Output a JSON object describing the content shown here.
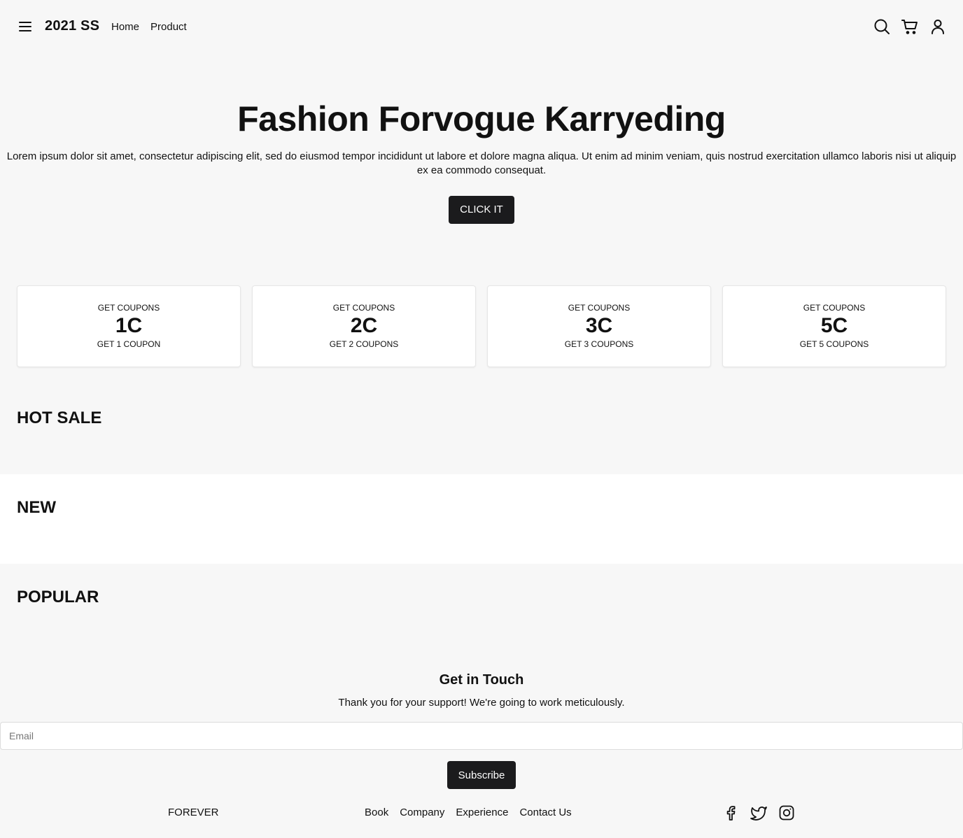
{
  "header": {
    "brand": "2021 SS",
    "nav": [
      "Home",
      "Product"
    ],
    "icons": [
      "menu-icon",
      "search-icon",
      "cart-icon",
      "user-icon"
    ]
  },
  "hero": {
    "title": "Fashion Forvogue Karryeding",
    "description": "Lorem ipsum dolor sit amet, consectetur adipiscing elit, sed do eiusmod tempor incididunt ut labore et dolore magna aliqua. Ut enim ad minim veniam, quis nostrud exercitation ullamco laboris nisi ut aliquip ex ea commodo consequat.",
    "button": "CLICK IT"
  },
  "coupons": [
    {
      "top": "GET COUPONS",
      "value": "1C",
      "bottom": "GET 1 COUPON"
    },
    {
      "top": "GET COUPONS",
      "value": "2C",
      "bottom": "GET 2 COUPONS"
    },
    {
      "top": "GET COUPONS",
      "value": "3C",
      "bottom": "GET 3 COUPONS"
    },
    {
      "top": "GET COUPONS",
      "value": "5C",
      "bottom": "GET 5 COUPONS"
    }
  ],
  "sections": {
    "hot_sale": "HOT SALE",
    "new": "NEW",
    "popular": "POPULAR"
  },
  "contact": {
    "title": "Get in Touch",
    "description": "Thank you for your support! We're going to work meticulously.",
    "email_placeholder": "Email",
    "email_value": "",
    "subscribe": "Subscribe"
  },
  "footer": {
    "brand": "FOREVER",
    "links": [
      "Book",
      "Company",
      "Experience",
      "Contact Us"
    ],
    "social_icons": [
      "facebook-icon",
      "twitter-icon",
      "instagram-icon"
    ]
  }
}
